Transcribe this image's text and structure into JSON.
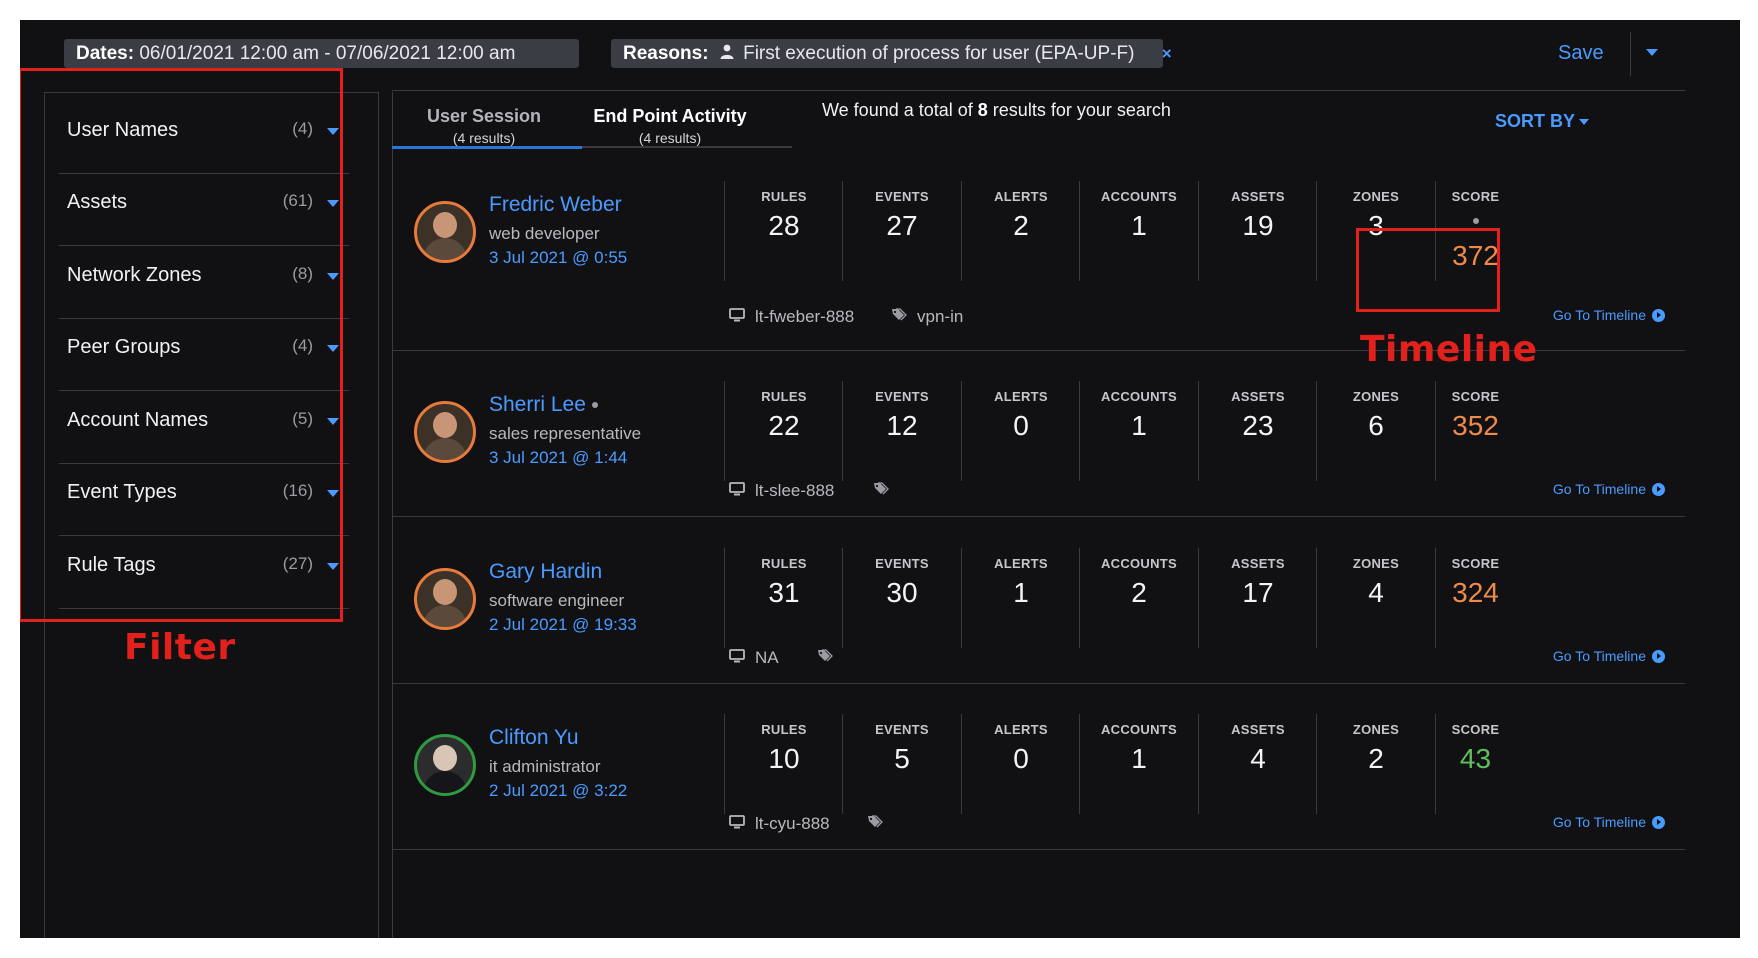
{
  "filters_bar": {
    "dates_label": "Dates:",
    "dates_value": "06/01/2021 12:00 am - 07/06/2021 12:00 am",
    "reasons_label": "Reasons:",
    "reasons_value": "First execution of process for user (EPA-UP-F)",
    "save_label": "Save"
  },
  "sidebar": {
    "items": [
      {
        "label": "User Names",
        "count": "(4)"
      },
      {
        "label": "Assets",
        "count": "(61)"
      },
      {
        "label": "Network Zones",
        "count": "(8)"
      },
      {
        "label": "Peer Groups",
        "count": "(4)"
      },
      {
        "label": "Account Names",
        "count": "(5)"
      },
      {
        "label": "Event Types",
        "count": "(16)"
      },
      {
        "label": "Rule Tags",
        "count": "(27)"
      }
    ]
  },
  "annotations": {
    "filter_label": "Filter",
    "timeline_label": "Timeline"
  },
  "tabs": [
    {
      "title": "User Session",
      "sub": "(4 results)"
    },
    {
      "title": "End Point Activity",
      "sub": "(4 results)"
    }
  ],
  "summary": {
    "prefix": "We found a total of ",
    "count": "8",
    "suffix": " results for your search"
  },
  "sort_label": "SORT BY",
  "stat_labels": [
    "RULES",
    "EVENTS",
    "ALERTS",
    "ACCOUNTS",
    "ASSETS",
    "ZONES"
  ],
  "score_label": "SCORE",
  "goto_label": "Go To Timeline",
  "colors": {
    "accent": "#4a9bff",
    "score_high": "#f08a4b",
    "score_low": "#5fbf5c",
    "annotation": "#e2211c"
  },
  "results": [
    {
      "name": "Fredric Weber",
      "role": "web developer",
      "time": "3 Jul 2021 @ 0:55",
      "stats": [
        "28",
        "27",
        "2",
        "1",
        "19",
        "3"
      ],
      "score": "372",
      "asset": "lt-fweber-888",
      "tag": "vpn-in"
    },
    {
      "name": "Sherri Lee",
      "role": "sales representative",
      "time": "3 Jul 2021 @ 1:44",
      "stats": [
        "22",
        "12",
        "0",
        "1",
        "23",
        "6"
      ],
      "score": "352",
      "asset": "lt-slee-888",
      "tag": ""
    },
    {
      "name": "Gary Hardin",
      "role": "software engineer",
      "time": "2 Jul 2021 @ 19:33",
      "stats": [
        "31",
        "30",
        "1",
        "2",
        "17",
        "4"
      ],
      "score": "324",
      "asset": "NA",
      "tag": ""
    },
    {
      "name": "Clifton Yu",
      "role": "it administrator",
      "time": "2 Jul 2021 @ 3:22",
      "stats": [
        "10",
        "5",
        "0",
        "1",
        "4",
        "2"
      ],
      "score": "43",
      "asset": "lt-cyu-888",
      "tag": ""
    }
  ]
}
